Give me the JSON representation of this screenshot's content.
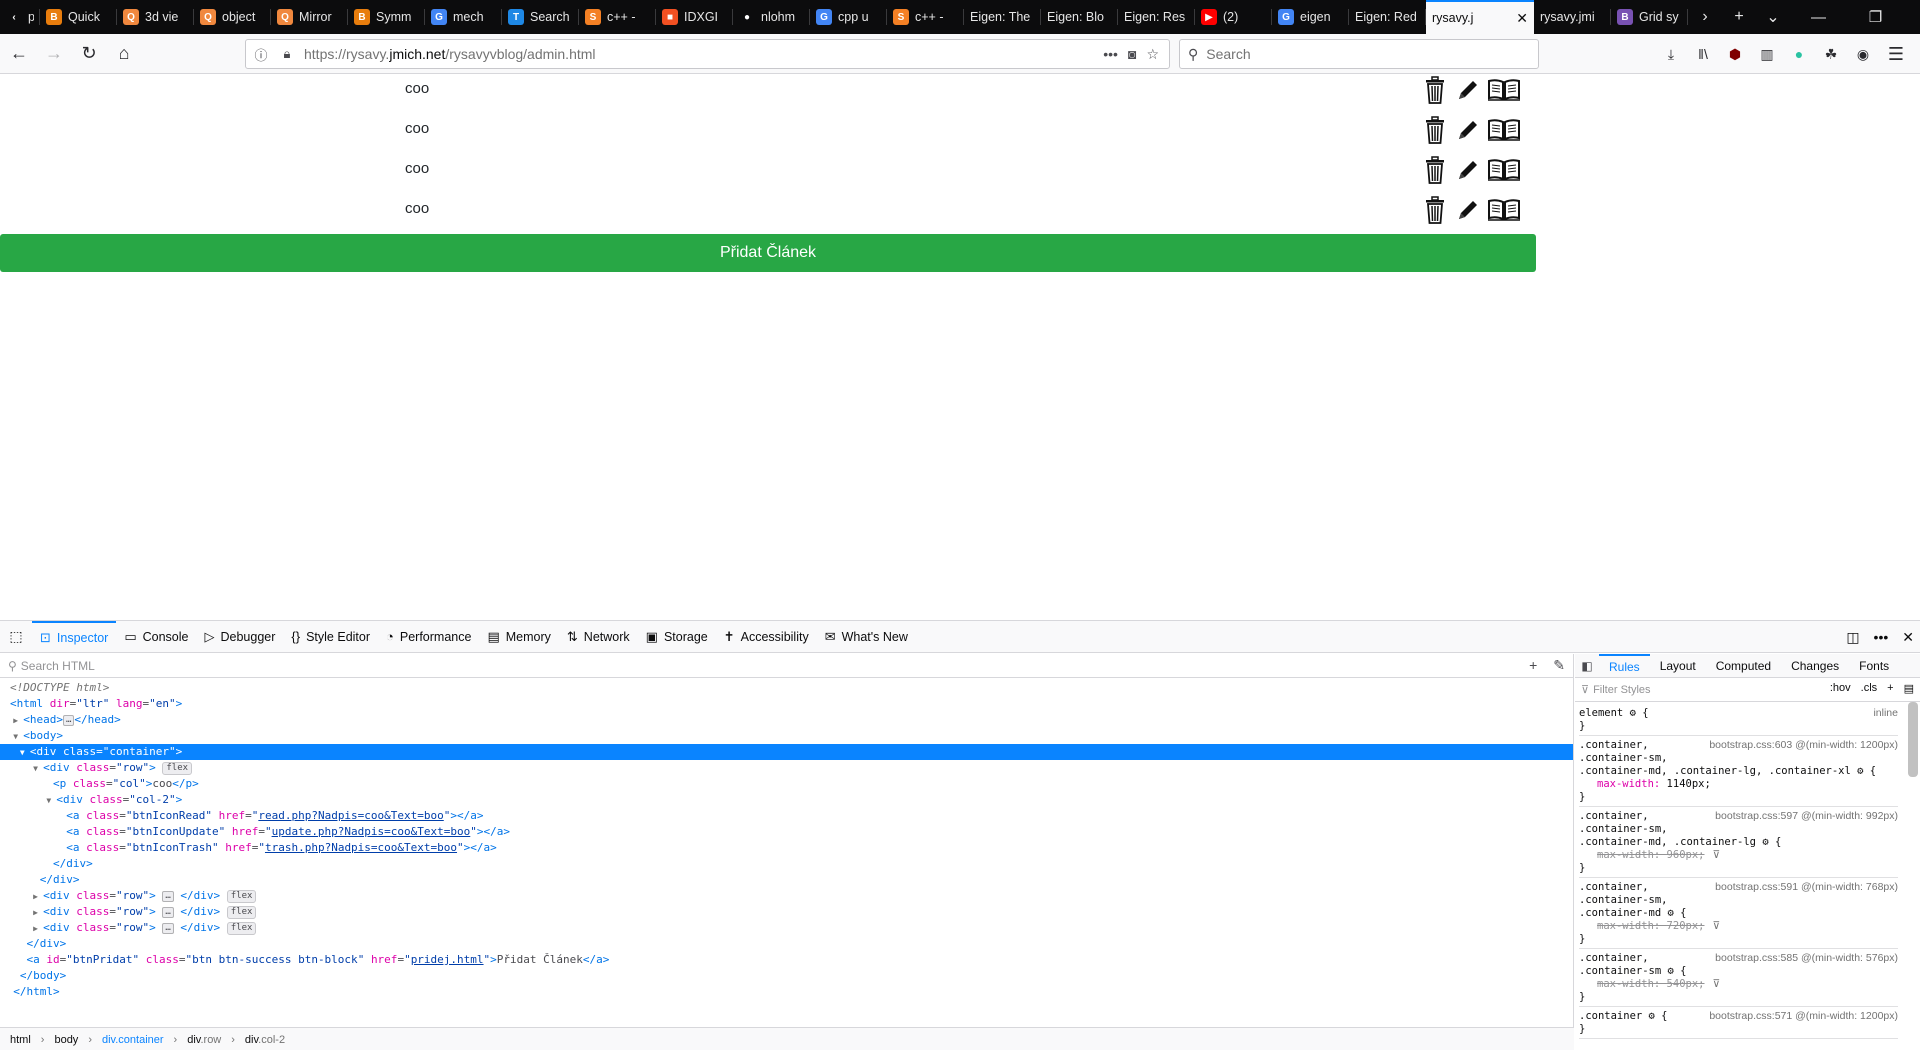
{
  "browser": {
    "tabs": [
      {
        "title": "pt",
        "favicon": "‹",
        "color": "#0c0c0d"
      },
      {
        "title": "Quick",
        "favicon": "B",
        "color": "#e87d0d"
      },
      {
        "title": "3d vie",
        "favicon": "Q",
        "color": "#f0883e"
      },
      {
        "title": "object",
        "favicon": "Q",
        "color": "#f0883e"
      },
      {
        "title": "Mirror",
        "favicon": "Q",
        "color": "#f0883e"
      },
      {
        "title": "Symm",
        "favicon": "B",
        "color": "#e87d0d"
      },
      {
        "title": "mech",
        "favicon": "G",
        "color": "#4285f4"
      },
      {
        "title": "Search",
        "favicon": "T",
        "color": "#1e88e5"
      },
      {
        "title": "c++ -",
        "favicon": "S",
        "color": "#f48024"
      },
      {
        "title": "IDXGI",
        "favicon": "■",
        "color": "#f25022"
      },
      {
        "title": "nlohm",
        "favicon": "●",
        "color": "#0c0c0d"
      },
      {
        "title": "cpp u",
        "favicon": "G",
        "color": "#4285f4"
      },
      {
        "title": "c++ -",
        "favicon": "S",
        "color": "#f48024"
      },
      {
        "title": "Eigen: The",
        "favicon": "",
        "color": ""
      },
      {
        "title": "Eigen: Blo",
        "favicon": "",
        "color": ""
      },
      {
        "title": "Eigen: Res",
        "favicon": "",
        "color": ""
      },
      {
        "title": "(2)",
        "favicon": "▶",
        "color": "#ff0000"
      },
      {
        "title": "eigen",
        "favicon": "G",
        "color": "#4285f4"
      },
      {
        "title": "Eigen: Red",
        "favicon": "",
        "color": ""
      }
    ],
    "active_tab": {
      "title": "rysavy.j",
      "close": "✕"
    },
    "tabs_after": [
      {
        "title": "rysavy.jmi",
        "favicon": "",
        "color": ""
      },
      {
        "title": "Grid sy",
        "favicon": "B",
        "color": "#7952b3"
      }
    ],
    "url_prefix": "https://rysavy.",
    "url_domain": "jmich.net",
    "url_path": "/rysavyvblog/admin.html",
    "search_placeholder": "Search"
  },
  "page": {
    "rows": [
      {
        "text": "coo"
      },
      {
        "text": "coo"
      },
      {
        "text": "coo"
      },
      {
        "text": "coo"
      }
    ],
    "add_button": "Přidat Článek"
  },
  "devtools": {
    "tabs": [
      {
        "label": "Inspector",
        "icon": "inspector-icon",
        "glyph": "⊡"
      },
      {
        "label": "Console",
        "icon": "console-icon",
        "glyph": "▭"
      },
      {
        "label": "Debugger",
        "icon": "debugger-icon",
        "glyph": "▷"
      },
      {
        "label": "Style Editor",
        "icon": "style-editor-icon",
        "glyph": "{}"
      },
      {
        "label": "Performance",
        "icon": "performance-icon",
        "glyph": "◔"
      },
      {
        "label": "Memory",
        "icon": "memory-icon",
        "glyph": "▤"
      },
      {
        "label": "Network",
        "icon": "network-icon",
        "glyph": "⇅"
      },
      {
        "label": "Storage",
        "icon": "storage-icon",
        "glyph": "▣"
      },
      {
        "label": "Accessibility",
        "icon": "accessibility-icon",
        "glyph": "✝"
      },
      {
        "label": "What's New",
        "icon": "whats-new-icon",
        "glyph": "✉"
      }
    ],
    "search_placeholder": "Search HTML",
    "sidebar_tabs": [
      "Rules",
      "Layout",
      "Computed",
      "Changes",
      "Fonts"
    ],
    "filter_placeholder": "Filter Styles",
    "filter_hov": ":hov",
    "filter_cls": ".cls",
    "breadcrumbs": [
      {
        "tag": "html",
        "cls": ""
      },
      {
        "tag": "body",
        "cls": ""
      },
      {
        "tag": "div",
        "cls": ".container"
      },
      {
        "tag": "div",
        "cls": ".row"
      },
      {
        "tag": "div",
        "cls": ".col-2"
      }
    ],
    "markup": {
      "doctype": "<!DOCTYPE html>",
      "html_open": "<html dir=\"ltr\" lang=\"en\">",
      "head": "head",
      "body": "body",
      "container": "div class=\"container\"",
      "row_attr": "row",
      "flex": "flex",
      "p_col": "col",
      "p_text": "coo",
      "col2": "col-2",
      "a1_class": "btnIconRead",
      "a1_href": "read.php?Nadpis=coo&Text=boo",
      "a2_class": "btnIconUpdate",
      "a2_href": "update.php?Nadpis=coo&Text=boo",
      "a3_class": "btnIconTrash",
      "a3_href": "trash.php?Nadpis=coo&Text=boo",
      "pridat_id": "btnPridat",
      "pridat_class": "btn btn-success btn-block",
      "pridat_href": "pridej.html",
      "pridat_text": "Přidat Článek"
    },
    "rules": [
      {
        "selector": ".container,\n.container-sm,\n.container-md, .container-lg, .container-xl",
        "source": "bootstrap.css:603 @(min-width: 1200px)",
        "prop": "max-width",
        "value": "1140px",
        "struck": false
      },
      {
        "selector": ".container,\n.container-sm,\n.container-md, .container-lg",
        "source": "bootstrap.css:597 @(min-width: 992px)",
        "prop": "max-width",
        "value": "960px",
        "struck": true
      },
      {
        "selector": ".container,\n.container-sm,\n.container-md",
        "source": "bootstrap.css:591 @(min-width: 768px)",
        "prop": "max-width",
        "value": "720px",
        "struck": true
      },
      {
        "selector": ".container,\n.container-sm",
        "source": "bootstrap.css:585 @(min-width: 576px)",
        "prop": "max-width",
        "value": "540px",
        "struck": true
      },
      {
        "selector": ".container",
        "source": "bootstrap.css:571 @(min-width: 1200px)",
        "prop": "",
        "value": "",
        "struck": false
      }
    ],
    "element_rule": "element",
    "element_src": "inline"
  }
}
